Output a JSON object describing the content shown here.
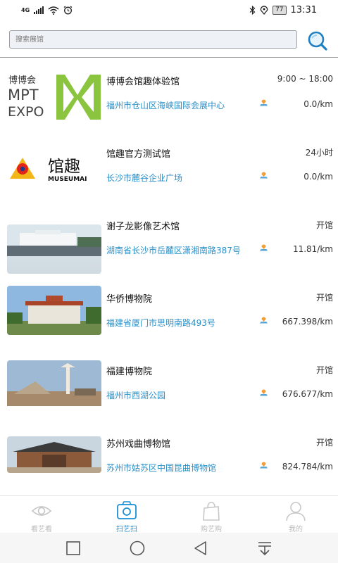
{
  "status": {
    "network": "4G",
    "time": "13:31",
    "battery": "77"
  },
  "search": {
    "placeholder": "搜索展馆"
  },
  "venues": [
    {
      "name": "博博会馆趣体验馆",
      "hours": "9:00 ~ 18:00",
      "address": "福州市仓山区海峡国际会展中心",
      "distance": "0.0/km",
      "logo_lines": [
        "博博会",
        "MPT",
        "EXPO"
      ]
    },
    {
      "name": "馆趣官方测试馆",
      "hours": "24小时",
      "address": "长沙市麓谷企业广场",
      "distance": "0.0/km",
      "logo_lines": [
        "馆趣",
        "MUSEUMAI"
      ]
    },
    {
      "name": "谢子龙影像艺术馆",
      "hours": "开馆",
      "address": "湖南省长沙市岳麓区潇湘南路387号",
      "distance": "11.81/km"
    },
    {
      "name": "华侨博物院",
      "hours": "开馆",
      "address": "福建省厦门市思明南路493号",
      "distance": "667.398/km"
    },
    {
      "name": "福建博物院",
      "hours": "开馆",
      "address": "福州市西湖公园",
      "distance": "676.677/km"
    },
    {
      "name": "苏州戏曲博物馆",
      "hours": "开馆",
      "address": "苏州市姑苏区中国昆曲博物馆",
      "distance": "824.784/km"
    }
  ],
  "tabs": [
    {
      "label": "看艺看",
      "icon": "eye-icon"
    },
    {
      "label": "扫艺扫",
      "icon": "scan-icon"
    },
    {
      "label": "购艺购",
      "icon": "bag-icon"
    },
    {
      "label": "我的",
      "icon": "user-icon"
    }
  ],
  "colors": {
    "accent": "#1a8fd6",
    "address": "#2a8fc7",
    "logo_green": "#8bc53f"
  }
}
